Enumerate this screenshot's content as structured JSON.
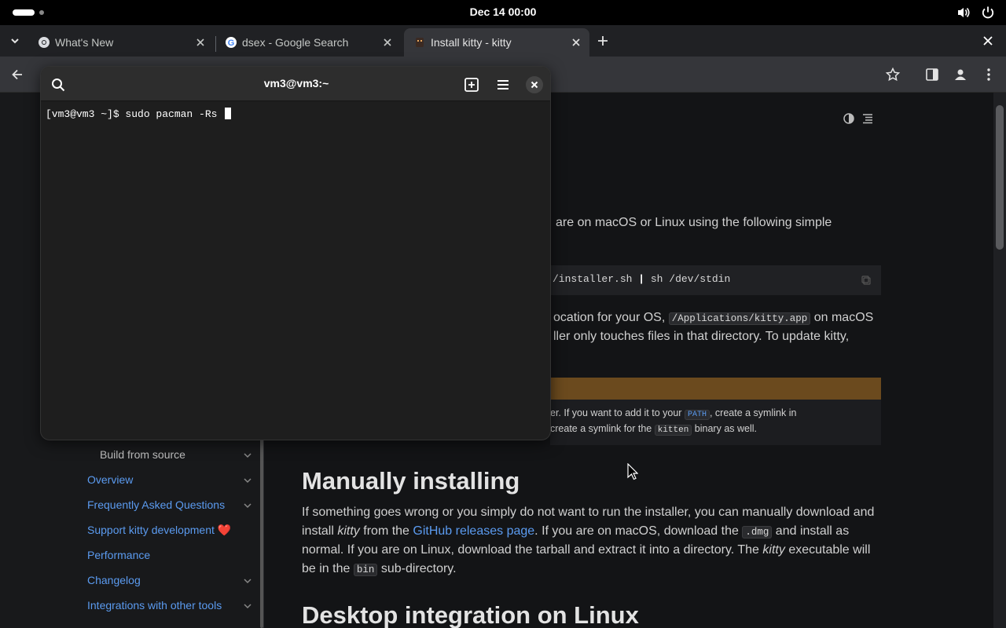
{
  "topbar": {
    "clock": "Dec 14  00:00"
  },
  "tabs": [
    {
      "title": "What's New",
      "favicon": "chrome-icon"
    },
    {
      "title": "dsex - Google Search",
      "favicon": "google-icon"
    },
    {
      "title": "Install kitty - kitty",
      "favicon": "kitty-icon"
    }
  ],
  "terminal": {
    "title": "vm3@vm3:~",
    "prompt": "[vm3@vm3 ~]$ ",
    "command": "sudo pacman -Rs "
  },
  "page": {
    "intro_fragment": "are on macOS or Linux using the following simple",
    "code_fragment_a": "/installer.sh",
    "code_pipe": "|",
    "code_fragment_b": "sh /dev/stdin",
    "p2_a": "ocation for your OS,",
    "p2_code": "/Applications/kitty.app",
    "p2_b": "on macOS",
    "p2_line2": "ller only touches files in that directory. To update kitty,",
    "admon_a": "er. If you want to add it to your",
    "admon_code1": "PATH",
    "admon_b": ", create a symlink in",
    "admon_c": "create a symlink for the",
    "admon_code2": "kitten",
    "admon_d": "binary as well.",
    "h_manual": "Manually installing",
    "m1": "If something goes wrong or you simply do not want to run the installer, you can manually download and",
    "m2_a": "install",
    "m2_kitty": "kitty",
    "m2_b": "from the",
    "m2_link": "GitHub releases page",
    "m2_c": ". If you are on macOS, download the",
    "m2_code": ".dmg",
    "m2_d": "and install as",
    "m3_a": "normal. If you are on Linux, download the tarball and extract it into a directory. The",
    "m3_kitty": "kitty",
    "m3_b": "executable will",
    "m4_a": "be in the",
    "m4_code": "bin",
    "m4_b": "sub-directory.",
    "h_desktop": "Desktop integration on Linux"
  },
  "sidebar": {
    "items": [
      {
        "label": "Build from source",
        "chevron": true
      },
      {
        "label": "Overview",
        "chevron": true
      },
      {
        "label": "Frequently Asked Questions",
        "chevron": true
      },
      {
        "label": "Support kitty development ❤️",
        "chevron": false
      },
      {
        "label": "Performance",
        "chevron": false
      },
      {
        "label": "Changelog",
        "chevron": true
      },
      {
        "label": "Integrations with other tools",
        "chevron": true
      }
    ]
  },
  "colors": {
    "accent": "#5b9bf0",
    "admonition": "#6b4a1e"
  }
}
